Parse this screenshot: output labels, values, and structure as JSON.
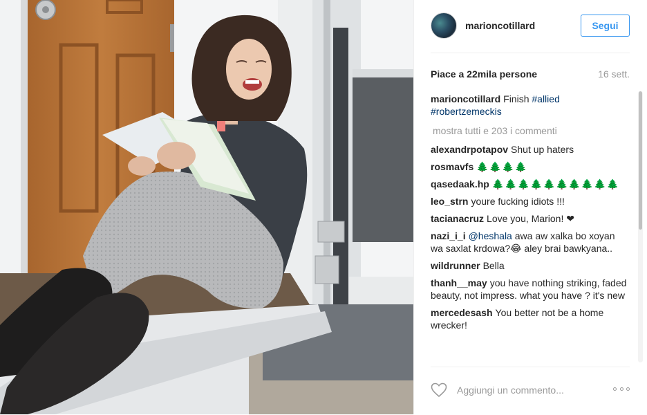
{
  "post": {
    "photo_description_icon": "post-photo",
    "author": "marioncotillard",
    "follow_label": "Segui",
    "likes_text": "Piace a 22mila persone",
    "time_ago": "16 sett.",
    "caption": {
      "user": "marioncotillard",
      "text_prefix": "Finish ",
      "tag1": "#allied",
      "tag2": "#robertzemeckis"
    },
    "show_all_comments": "mostra tutti e 203 i commenti",
    "comments": [
      {
        "user": "alexandrpotapov",
        "text": "Shut up haters"
      },
      {
        "user": "rosmavfs",
        "text": "🌲🌲🌲🌲"
      },
      {
        "user": "qasedaak.hp",
        "text": "🌲🌲🌲🌲🌲🌲🌲🌲🌲🌲"
      },
      {
        "user": "leo_strn",
        "text": "youre fucking idiots !!!"
      },
      {
        "user": "tacianacruz",
        "text": "Love you, Marion! ❤"
      },
      {
        "user": "nazi_i_i",
        "mention": "@heshala",
        "text": " awa aw xalka bo xoyan wa saxlat krdowa?😂 aley brai bawkyana.."
      },
      {
        "user": "wildrunner",
        "text": "Bella"
      },
      {
        "user": "thanh__may",
        "text": "you have nothing striking, faded beauty, not impress. what you have ? it's new"
      },
      {
        "user": "mercedesash",
        "text": "You better not be a home wrecker!"
      }
    ],
    "add_comment_placeholder": "Aggiungi un commento...",
    "icons": {
      "like": "heart-icon",
      "more": "more-options-icon"
    },
    "colors": {
      "accent": "#3897f0",
      "hashtag": "#003569",
      "muted": "#999999"
    }
  }
}
